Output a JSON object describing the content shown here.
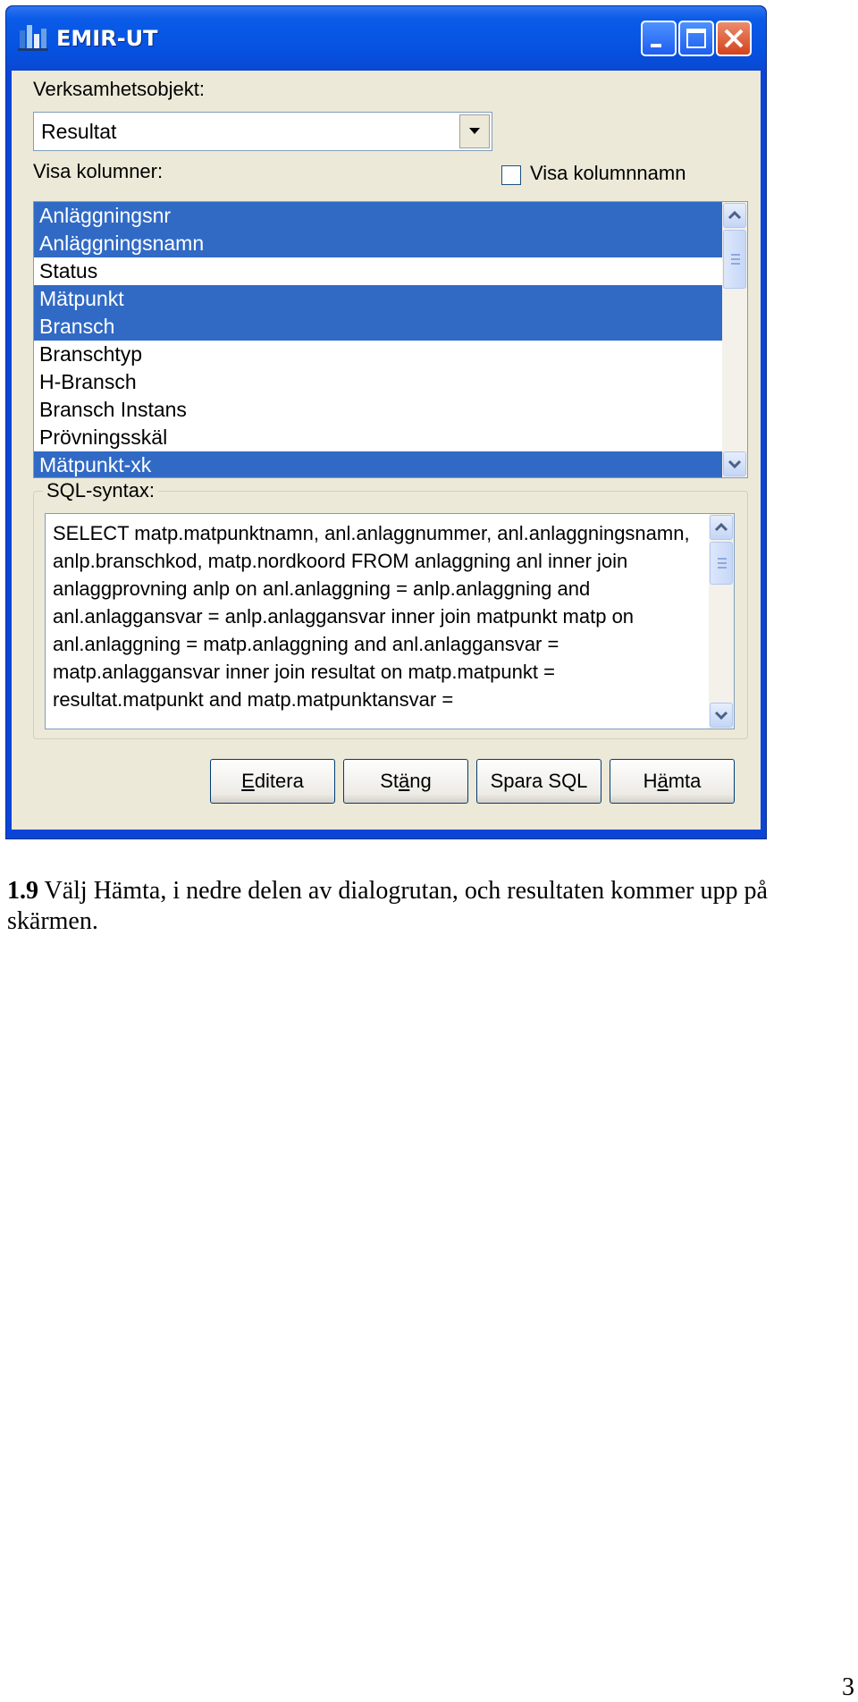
{
  "window": {
    "title": "EMIR-UT",
    "colors": {
      "titlebar": "#0651e0",
      "selection": "#316ac5",
      "client": "#ece9d8",
      "close_button": "#d3431c"
    }
  },
  "form": {
    "business_object_label": "Verksamhetsobjekt:",
    "business_object_value": "Resultat",
    "show_columns_label": "Visa kolumner:",
    "show_column_names_label": "Visa kolumnnamn",
    "show_column_names_checked": false,
    "columns": [
      {
        "label": "Anläggningsnr",
        "selected": true
      },
      {
        "label": "Anläggningsnamn",
        "selected": true
      },
      {
        "label": "Status",
        "selected": false
      },
      {
        "label": "Mätpunkt",
        "selected": true
      },
      {
        "label": "Bransch",
        "selected": true
      },
      {
        "label": "Branschtyp",
        "selected": false
      },
      {
        "label": "H-Bransch",
        "selected": false
      },
      {
        "label": "Bransch Instans",
        "selected": false
      },
      {
        "label": "Prövningsskäl",
        "selected": false
      },
      {
        "label": "Mätpunkt-xk",
        "selected": true
      }
    ],
    "sql_group_label": "SQL-syntax:",
    "sql_text": "SELECT matp.matpunktnamn, anl.anlaggnummer, anl.anlaggningsnamn, anlp.branschkod, matp.nordkoord FROM anlaggning anl inner join anlaggprovning anlp on anl.anlaggning = anlp.anlaggning and anl.anlaggansvar = anlp.anlaggansvar inner join matpunkt matp on anl.anlaggning = matp.anlaggning and anl.anlaggansvar = matp.anlaggansvar inner join resultat on matp.matpunkt = resultat.matpunkt and matp.matpunktansvar ="
  },
  "buttons": {
    "edit": {
      "label": "Editera",
      "mnemonic": "E"
    },
    "close": {
      "label": "Stäng",
      "mnemonic": "ä"
    },
    "save_sql": {
      "label": "Spara SQL",
      "mnemonic": ""
    },
    "fetch": {
      "label": "Hämta",
      "mnemonic": "ä"
    }
  },
  "caption": {
    "step": "1.9",
    "text": " Välj Hämta, i nedre delen av dialogrutan, och resultaten kommer upp på skärmen."
  },
  "page_number": "3",
  "icons": [
    "app-icon",
    "minimize-icon",
    "maximize-icon",
    "close-icon",
    "dropdown-arrow-icon",
    "scroll-up-icon",
    "scroll-down-icon"
  ]
}
